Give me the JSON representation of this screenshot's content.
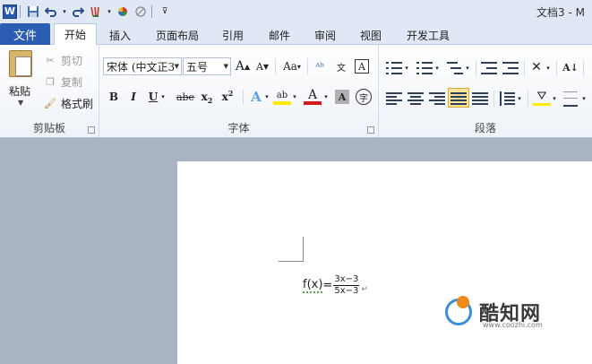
{
  "titlebar": {
    "title": "文档3 - M",
    "word_logo": "W",
    "icons": [
      "word-logo",
      "save-icon",
      "undo-icon",
      "redo-icon",
      "format-painter-icon",
      "color-icon",
      "eraser-icon",
      "customize-icon"
    ]
  },
  "tabs": {
    "file": "文件",
    "items": [
      "开始",
      "插入",
      "页面布局",
      "引用",
      "邮件",
      "审阅",
      "视图",
      "开发工具"
    ],
    "active": "开始"
  },
  "clipboard": {
    "paste": "粘贴",
    "cut": "剪切",
    "copy": "复制",
    "format_painter": "格式刷",
    "group_label": "剪贴板"
  },
  "font": {
    "font_name": "宋体 (中文正3",
    "font_size": "五号",
    "grow": "A",
    "shrink": "A",
    "change_case": "Aa",
    "bold": "B",
    "italic": "I",
    "underline": "U",
    "strike": "abe",
    "subscript": "x",
    "superscript": "x",
    "sub_mark": "2",
    "sup_mark": "2",
    "text_effect": "A",
    "highlight": "ab",
    "font_color": "A",
    "char_shading": "A",
    "enclose": "字",
    "group_label": "字体"
  },
  "paragraph": {
    "group_label": "段落"
  },
  "document": {
    "formula_fn": "f(x)",
    "equals": "=",
    "numerator": "3x−3",
    "denominator": "5x−3",
    "paragraph_mark": "↵"
  },
  "watermark": {
    "text": "酷知网",
    "url": "www.coozhi.com"
  },
  "colors": {
    "file_tab": "#2b5eb2",
    "ribbon_bg": "#ffffff",
    "titlebar_bg": "#dfe8f4",
    "doc_bg": "#a9b3c1",
    "highlight_yellow": "#ffe39a"
  }
}
